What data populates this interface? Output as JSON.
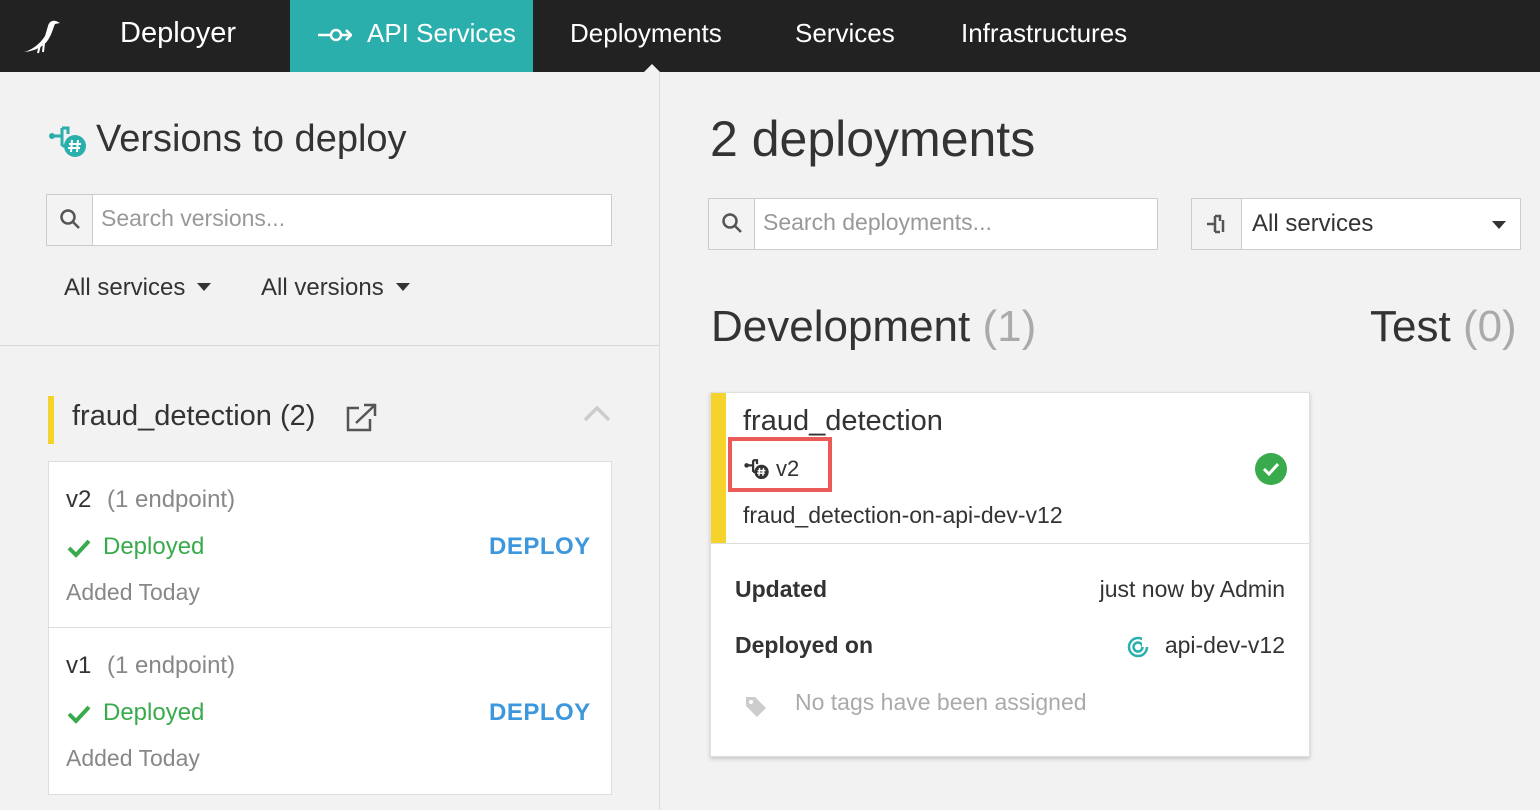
{
  "header": {
    "app_name": "Deployer",
    "tabs": [
      {
        "label": "API Services",
        "active": true
      },
      {
        "label": "Deployments",
        "active": false
      },
      {
        "label": "Services",
        "active": false
      },
      {
        "label": "Infrastructures",
        "active": false
      }
    ],
    "logo_icon": "bird-logo-icon",
    "active_tab_color": "#2aafac"
  },
  "left": {
    "title": "Versions to deploy",
    "search_placeholder": "Search versions...",
    "filters": {
      "services": "All services",
      "versions": "All versions"
    },
    "group": {
      "title": "fraud_detection (2)",
      "accent_color": "#f5d32a",
      "versions": [
        {
          "name": "v2",
          "endpoints": "(1 endpoint)",
          "status": "Deployed",
          "action": "DEPLOY",
          "added": "Added Today"
        },
        {
          "name": "v1",
          "endpoints": "(1 endpoint)",
          "status": "Deployed",
          "action": "DEPLOY",
          "added": "Added Today"
        }
      ]
    }
  },
  "right": {
    "title": "2 deployments",
    "search_placeholder": "Search deployments...",
    "service_filter": "All services",
    "stages": [
      {
        "name": "Development",
        "count": "(1)"
      },
      {
        "name": "Test",
        "count": "(0)"
      }
    ],
    "deployment_card": {
      "service": "fraud_detection",
      "version": "v2",
      "deployment_name": "fraud_detection-on-api-dev-v12",
      "status": "ok",
      "updated_label": "Updated",
      "updated_value": "just now by Admin",
      "deployed_on_label": "Deployed on",
      "deployed_on_value": "api-dev-v12",
      "tags_text": "No tags have been assigned"
    }
  },
  "colors": {
    "deployed_green": "#3aab4c",
    "deploy_link_blue": "#3d97dd",
    "highlight_red": "#ec5a57"
  }
}
